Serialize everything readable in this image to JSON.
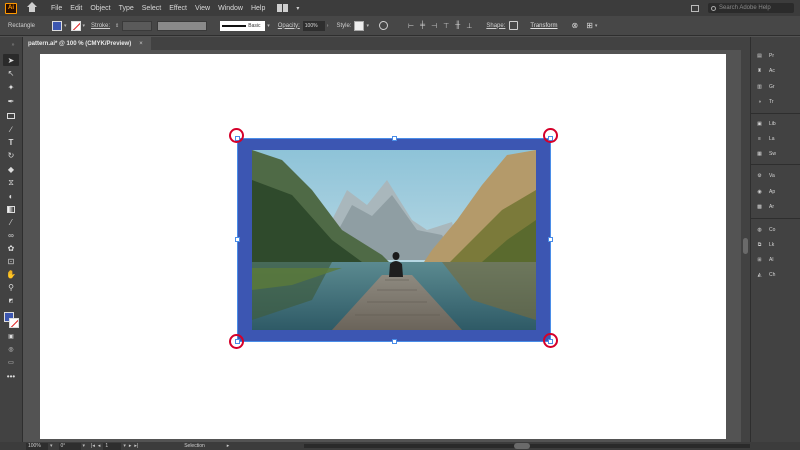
{
  "app": {
    "logo": "Ai"
  },
  "menu": [
    "File",
    "Edit",
    "Object",
    "Type",
    "Select",
    "Effect",
    "View",
    "Window",
    "Help"
  ],
  "search": {
    "placeholder": "Search Adobe Help"
  },
  "control": {
    "object_type": "Rectangle",
    "stroke_label": "Stroke:",
    "line_style": "Basic",
    "opacity_label": "Opacity:",
    "opacity_value": "100%",
    "style_label": "Style:",
    "shape_label": "Shape:",
    "transform_label": "Transform",
    "fill_color": "#3d57b0"
  },
  "tab": {
    "title": "pattern.ai* @ 100 % (CMYK/Preview)",
    "close": "×"
  },
  "panels": [
    {
      "icon": "properties-icon",
      "label": "Pr"
    },
    {
      "icon": "actions-icon",
      "label": "Ac"
    },
    {
      "icon": "gradient-icon",
      "label": "Gr"
    },
    {
      "icon": "transparency-icon",
      "label": "Tr"
    },
    {
      "icon": "libraries-icon",
      "label": "Lib"
    },
    {
      "icon": "layers-icon",
      "label": "La"
    },
    {
      "icon": "swatches-icon",
      "label": "Sw"
    },
    {
      "icon": "variables-icon",
      "label": "Va"
    },
    {
      "icon": "appearance-icon",
      "label": "Ap"
    },
    {
      "icon": "artboards-icon",
      "label": "Ar"
    },
    {
      "icon": "color-icon",
      "label": "Co"
    },
    {
      "icon": "links-icon",
      "label": "Lk"
    },
    {
      "icon": "align-icon",
      "label": "Al"
    },
    {
      "icon": "character-icon",
      "label": "Ch"
    }
  ],
  "status": {
    "zoom": "100%",
    "rotation": "0°",
    "artboard": "1",
    "tool": "Selection"
  }
}
